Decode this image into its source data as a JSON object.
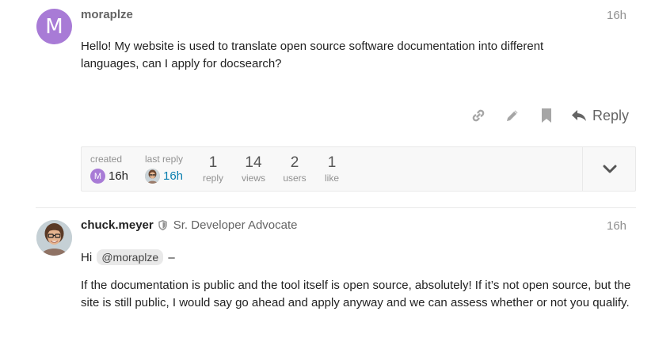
{
  "post1": {
    "avatar_letter": "M",
    "avatar_color": "#a87bd6",
    "username": "moraplze",
    "date": "16h",
    "body": "Hello! My website is used to translate open source software documentation into different languages, can I apply for docsearch?",
    "actions": {
      "icons": [
        "link-icon",
        "edit-icon",
        "bookmark-icon"
      ],
      "reply_icon": "reply-arrow-icon",
      "reply_label": "Reply"
    }
  },
  "topic_map": {
    "created_label": "created",
    "created_avatar_letter": "M",
    "created_date": "16h",
    "last_reply_label": "last reply",
    "last_reply_date": "16h",
    "stats": [
      {
        "value": "1",
        "label": "reply"
      },
      {
        "value": "14",
        "label": "views"
      },
      {
        "value": "2",
        "label": "users"
      },
      {
        "value": "1",
        "label": "like"
      }
    ],
    "toggle_icon": "chevron-down-icon"
  },
  "post2": {
    "username": "chuck.meyer",
    "badge_icon": "shield-icon",
    "user_title": "Sr. Developer Advocate",
    "date": "16h",
    "greeting_prefix": "Hi",
    "mention": "@moraplze",
    "greeting_suffix": "–",
    "paragraph": "If the documentation is public and the tool itself is open source, absolutely! If it’s not open source, but the site is still public, I would say go ahead and apply anyway and we can assess whether or not you qualify."
  },
  "colors": {
    "accent_link": "#0a7fb0",
    "muted_text": "#919191",
    "icon_gray": "#a0a0a0"
  }
}
